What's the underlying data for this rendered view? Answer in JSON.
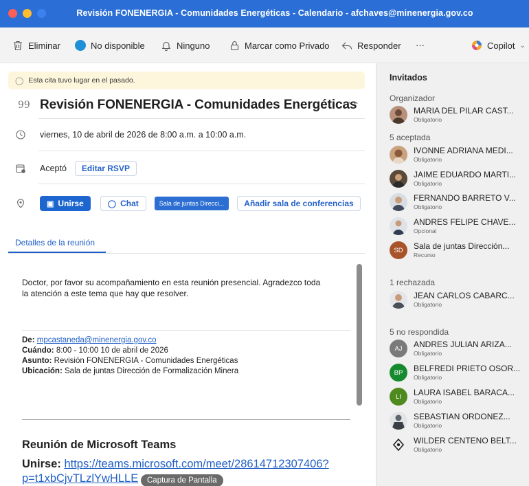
{
  "window": {
    "title": "Revisión FONENERGIA - Comunidades Energéticas - Calendario - afchaves@minenergia.gov.co"
  },
  "toolbar": {
    "delete": "Eliminar",
    "status": "No disponible",
    "reminder": "Ninguno",
    "private": "Marcar como Privado",
    "reply": "Responder",
    "more": "···",
    "copilot": "Copilot",
    "colors": {
      "status_dot": "#1f8fd6"
    }
  },
  "event": {
    "notice": "Esta cita tuvo lugar en el pasado.",
    "subject": "Revisión FONENERGIA - Comunidades Energéticas",
    "datetime": "viernes, 10 de abril de 2026 de 8:00 a.m. a 10:00 a.m.",
    "rsvp_status": "Aceptó",
    "edit_rsvp": "Editar RSVP",
    "join": "Unirse",
    "chat": "Chat",
    "room": "Sala de juntas Direcci...",
    "add_room": "Añadir sala de conferencias",
    "details_tab": "Detalles de la reunión"
  },
  "body": {
    "message_line1": "Doctor, por favor su acompañamiento en esta reunión presencial. Agradezco toda",
    "message_line2": "la atención a este tema que hay que resolver.",
    "from_label": "De:",
    "from_value": "mpcastaneda@minenergia.gov.co",
    "when_label": "Cuándo:",
    "when_value": "8:00 - 10:00 10 de abril de 2026",
    "subject_label": "Asunto:",
    "subject_value": "Revisión FONENERGIA - Comunidades Energéticas",
    "location_label": "Ubicación:",
    "location_value": "Sala de juntas Dirección de Formalización Minera",
    "teams_title": "Reunión de Microsoft Teams",
    "join_label": "Unirse:",
    "join_url_line1": "https://teams.microsoft.com/meet/28614712307406?",
    "join_url_line2": "p=t1xbCjvTLzlYwHLLE",
    "tooltip": "Captura de Pantalla"
  },
  "invitees": {
    "title": "Invitados",
    "organizer_label": "Organizador",
    "organizer": {
      "name": "MARIA DEL PILAR CAST...",
      "role": "Obligatorio"
    },
    "accepted_label": "5 aceptada",
    "accepted": [
      {
        "name": "IVONNE ADRIANA MEDI...",
        "role": "Obligatorio",
        "avatar_color": "#c9a27e"
      },
      {
        "name": "JAIME EDUARDO MARTI...",
        "role": "Obligatorio",
        "avatar_color": "#5a4a3a"
      },
      {
        "name": "FERNANDO BARRETO V...",
        "role": "Obligatorio",
        "avatar_color": "#3f4a5a"
      },
      {
        "name": "ANDRES FELIPE CHAVE...",
        "role": "Opcional",
        "avatar_color": "#2f3c52"
      },
      {
        "name": "Sala de juntas Dirección...",
        "role": "Recurso",
        "initials": "SD",
        "avatar_color": "#a8542b"
      }
    ],
    "declined_label": "1 rechazada",
    "declined": [
      {
        "name": "JEAN CARLOS CABARC...",
        "role": "Obligatorio",
        "avatar_color": "#4a4f58"
      }
    ],
    "noresponse_label": "5 no respondida",
    "noresponse": [
      {
        "name": "ANDRES JULIAN ARIZA...",
        "role": "Obligatorio",
        "initials": "AJ",
        "avatar_color": "#7a7a7a"
      },
      {
        "name": "BELFREDI PRIETO OSOR...",
        "role": "Obligatorio",
        "initials": "BP",
        "avatar_color": "#168a2e"
      },
      {
        "name": "LAURA ISABEL BARACA...",
        "role": "Obligatorio",
        "initials": "LI",
        "avatar_color": "#4e8a1e"
      },
      {
        "name": "SEBASTIAN ORDONEZ...",
        "role": "Obligatorio",
        "avatar_color": "#5d6670"
      },
      {
        "name": "WILDER CENTENO BELT...",
        "role": "Obligatorio",
        "icon": "location-pin-icon"
      }
    ]
  }
}
